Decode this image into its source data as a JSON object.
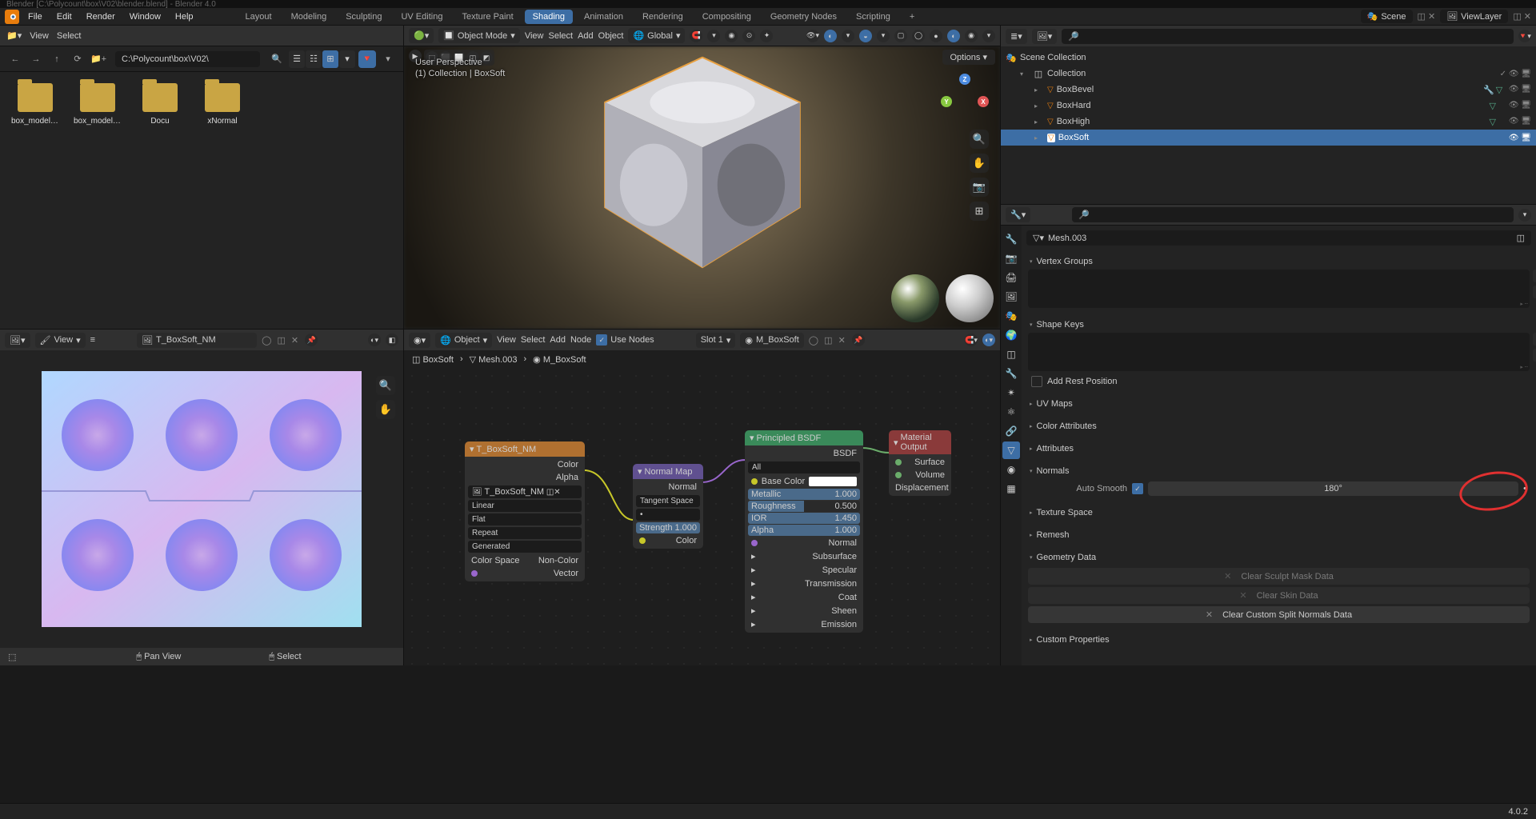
{
  "titlebar": "Blender [C:\\Polycount\\box\\V02\\blender.blend] - Blender 4.0",
  "menu": {
    "items": [
      "File",
      "Edit",
      "Render",
      "Window",
      "Help"
    ]
  },
  "workspaces": [
    "Layout",
    "Modeling",
    "Sculpting",
    "UV Editing",
    "Texture Paint",
    "Shading",
    "Animation",
    "Rendering",
    "Compositing",
    "Geometry Nodes",
    "Scripting"
  ],
  "workspace_active": "Shading",
  "scene": {
    "scene": "Scene",
    "layer": "ViewLayer"
  },
  "filebrowser": {
    "menu": [
      "View",
      "Select"
    ],
    "path": "C:\\Polycount\\box\\V02\\",
    "files": [
      "box_models...",
      "box_models...",
      "Docu",
      "xNormal"
    ]
  },
  "viewport": {
    "mode": "Object Mode",
    "menu": [
      "View",
      "Select",
      "Add",
      "Object"
    ],
    "orientation": "Global",
    "overlay_persp": "User Perspective",
    "overlay_obj": "(1) Collection | BoxSoft",
    "options": "Options"
  },
  "outliner": {
    "root": "Scene Collection",
    "collection": "Collection",
    "items": [
      "BoxBevel",
      "BoxHard",
      "BoxHigh",
      "BoxSoft"
    ],
    "selected": "BoxSoft"
  },
  "props": {
    "mesh": "Mesh.003",
    "panels": {
      "vertex_groups": "Vertex Groups",
      "shape_keys": "Shape Keys",
      "add_rest": "Add Rest Position",
      "uv_maps": "UV Maps",
      "color_attrs": "Color Attributes",
      "attrs": "Attributes",
      "normals": "Normals",
      "auto_smooth": "Auto Smooth",
      "auto_smooth_val": "180°",
      "tex_space": "Texture Space",
      "remesh": "Remesh",
      "geom_data": "Geometry Data",
      "clear_sculpt": "Clear Sculpt Mask Data",
      "clear_skin": "Clear Skin Data",
      "clear_normals": "Clear Custom Split Normals Data",
      "custom_props": "Custom Properties"
    }
  },
  "imgeditor": {
    "menu": [
      "View"
    ],
    "image": "T_BoxSoft_NM",
    "footer_pan": "Pan View",
    "footer_sel": "Select"
  },
  "nodes": {
    "menu": [
      "View",
      "Select",
      "Add",
      "Node"
    ],
    "use_nodes": "Use Nodes",
    "slot": "Slot 1",
    "material": "M_BoxSoft",
    "bread_obj": "BoxSoft",
    "bread_mesh": "Mesh.003",
    "bread_mat": "M_BoxSoft",
    "tex": {
      "title": "T_BoxSoft_NM",
      "out_color": "Color",
      "out_alpha": "Alpha",
      "image": "T_BoxSoft_NM",
      "interp": "Linear",
      "proj": "Flat",
      "ext": "Repeat",
      "src": "Generated",
      "cs": "Color Space",
      "ncs": "Non-Color",
      "vector": "Vector"
    },
    "nmap": {
      "title": "Normal Map",
      "out": "Normal",
      "space": "Tangent Space",
      "strength_l": "Strength",
      "strength_v": "1.000",
      "in_color": "Color"
    },
    "bsdf": {
      "title": "Principled BSDF",
      "out": "BSDF",
      "dist": "All",
      "base": "Base Color",
      "metallic_l": "Metallic",
      "metallic_v": "1.000",
      "rough_l": "Roughness",
      "rough_v": "0.500",
      "ior_l": "IOR",
      "ior_v": "1.450",
      "alpha_l": "Alpha",
      "alpha_v": "1.000",
      "normal": "Normal",
      "ss": "Subsurface",
      "spec": "Specular",
      "trans": "Transmission",
      "coat": "Coat",
      "sheen": "Sheen",
      "emit": "Emission"
    },
    "out": {
      "title": "Material Output",
      "surf": "Surface",
      "vol": "Volume",
      "disp": "Displacement"
    }
  },
  "status": {
    "version": "4.0.2"
  }
}
